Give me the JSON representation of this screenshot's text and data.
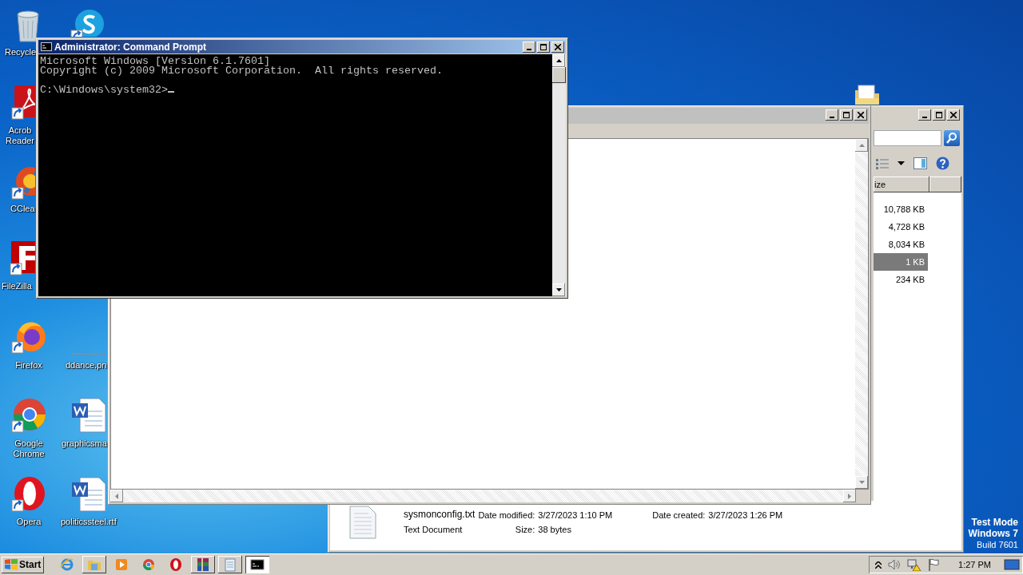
{
  "desktop_icons": [
    {
      "kind": "recycle",
      "label": "Recycle",
      "shortcut": false
    },
    {
      "kind": "skype",
      "shortcut": true
    },
    {
      "kind": "acrobat",
      "label": "Acrob Reader",
      "shortcut": true
    },
    {
      "kind": "ccleaner",
      "label": "CClea",
      "shortcut": true
    },
    {
      "kind": "filezilla",
      "label": "FileZilla",
      "shortcut": true
    },
    {
      "kind": "firefox",
      "label": "Firefox",
      "shortcut": true
    },
    {
      "kind": "blank",
      "label": "ddance.pn",
      "shortcut": false
    },
    {
      "kind": "chrome",
      "label": "Google Chrome",
      "shortcut": true
    },
    {
      "kind": "word",
      "label": "graphicsma",
      "shortcut": false
    },
    {
      "kind": "opera",
      "label": "Opera",
      "shortcut": true
    },
    {
      "kind": "word",
      "label": "politicssteel.rtf",
      "shortcut": false
    },
    {
      "kind": "folder"
    }
  ],
  "console": {
    "title": "Administrator: Command Prompt",
    "lines": [
      "Microsoft Windows [Version 6.1.7601]",
      "Copyright (c) 2009 Microsoft Corporation.  All rights reserved."
    ],
    "prompt": "C:\\Windows\\system32>"
  },
  "explorer": {
    "column": "ize",
    "rows": [
      {
        "size": "10,788 KB",
        "selected": false
      },
      {
        "size": "4,728 KB",
        "selected": false
      },
      {
        "size": "8,034 KB",
        "selected": false
      },
      {
        "size": "1 KB",
        "selected": true
      },
      {
        "size": "234 KB",
        "selected": false
      }
    ],
    "details": {
      "file_name": "sysmonconfig.txt",
      "file_type": "Text Document",
      "modified_label": "Date modified:",
      "modified": "3/27/2023 1:10 PM",
      "size_label": "Size:",
      "size": "38 bytes",
      "created_label": "Date created:",
      "created": "3/27/2023 1:26 PM"
    }
  },
  "system_notice": [
    "Test Mode",
    "Windows 7",
    "Build 7601"
  ],
  "taskbar": {
    "start": "Start",
    "apps": [
      {
        "kind": "ie",
        "selected": false
      },
      {
        "kind": "explorer",
        "selected": false
      },
      {
        "kind": "media",
        "selected": false
      },
      {
        "kind": "chrome",
        "selected": false
      },
      {
        "kind": "opera",
        "selected": false
      },
      {
        "kind": "winrar",
        "selected": false
      },
      {
        "kind": "notepad",
        "selected": false
      },
      {
        "kind": "cmd",
        "selected": true
      }
    ],
    "clock": "1:27 PM"
  }
}
